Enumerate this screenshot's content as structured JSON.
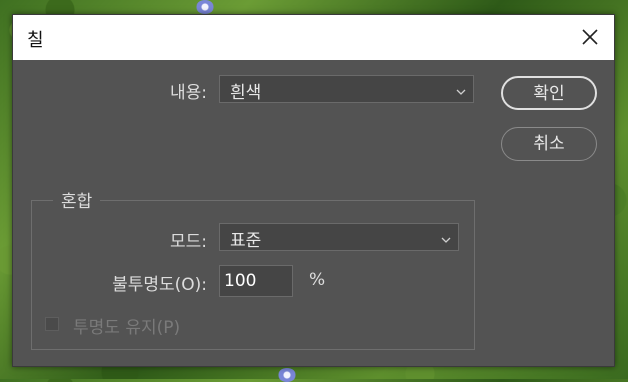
{
  "dialog": {
    "title": "칠",
    "close_icon": "close-icon"
  },
  "contents": {
    "label": "내용:",
    "selected": "흰색"
  },
  "buttons": {
    "ok_label": "확인",
    "cancel_label": "취소"
  },
  "blending": {
    "group_title": "혼합",
    "mode_label": "모드:",
    "mode_selected": "표준",
    "opacity_label": "불투명도(O):",
    "opacity_value": "100",
    "opacity_unit": "%",
    "preserve_label": "투명도 유지(P)",
    "preserve_checked": false
  },
  "colors": {
    "dialog_bg": "#535353",
    "field_bg": "#454545",
    "text": "#dcdcdc",
    "disabled_text": "#7a7a7a"
  }
}
